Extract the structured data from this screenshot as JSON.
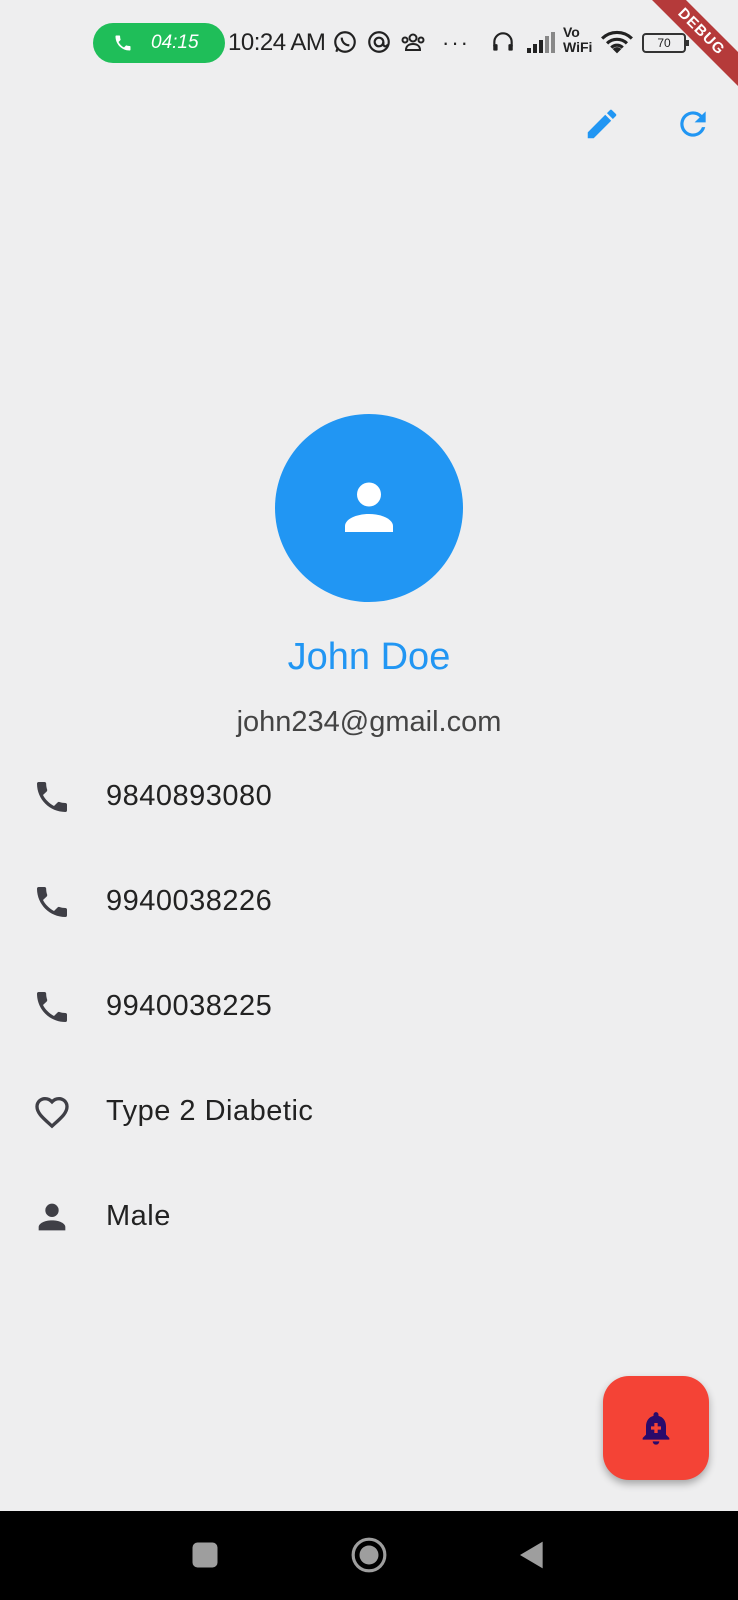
{
  "status_bar": {
    "call_timer": "04:15",
    "time": "10:24 AM",
    "network_label_top": "Vo",
    "network_label_bottom": "WiFi",
    "battery_level": "70",
    "debug_banner": "DEBUG"
  },
  "app_bar": {
    "actions": [
      "edit-icon",
      "refresh-icon"
    ],
    "accent_color": "#2196f3"
  },
  "profile": {
    "name": "John Doe",
    "email": "john234@gmail.com",
    "avatar_color": "#2196f3"
  },
  "details": [
    {
      "icon": "phone-icon",
      "text": "9840893080"
    },
    {
      "icon": "phone-icon",
      "text": "9940038226"
    },
    {
      "icon": "phone-icon",
      "text": "9940038225"
    },
    {
      "icon": "heart-outline-icon",
      "text": "Type 2 Diabetic"
    },
    {
      "icon": "person-icon",
      "text": "Male"
    }
  ],
  "fab": {
    "icon": "bell-plus-icon",
    "color": "#f44336"
  },
  "nav_bar": {
    "buttons": [
      "recents-button",
      "home-button",
      "back-button"
    ]
  }
}
